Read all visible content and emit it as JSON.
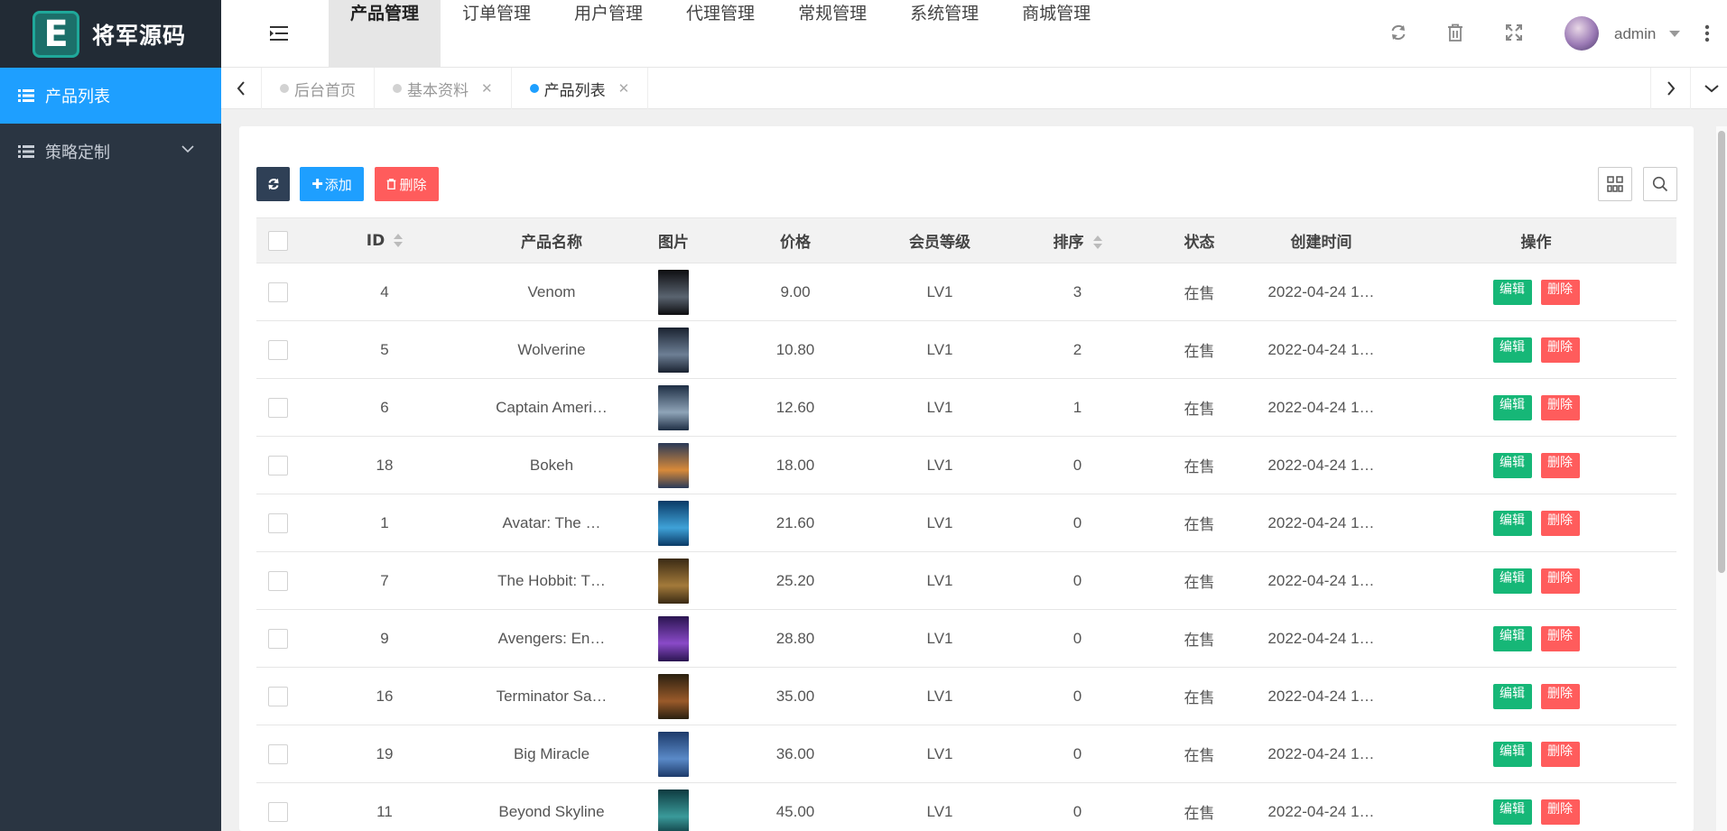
{
  "brand": {
    "logo_letter": "E",
    "name": "将军源码",
    "accent": "#1e9fff"
  },
  "sidebar": {
    "items": [
      {
        "label": "产品列表",
        "active": true
      },
      {
        "label": "策略定制",
        "active": false
      }
    ]
  },
  "header": {
    "nav": [
      {
        "label": "产品管理",
        "active": true
      },
      {
        "label": "订单管理",
        "active": false
      },
      {
        "label": "用户管理",
        "active": false
      },
      {
        "label": "代理管理",
        "active": false
      },
      {
        "label": "常规管理",
        "active": false
      },
      {
        "label": "系统管理",
        "active": false
      },
      {
        "label": "商城管理",
        "active": false
      }
    ],
    "icons": [
      "refresh-icon",
      "trash-icon",
      "fullscreen-icon"
    ],
    "user": "admin"
  },
  "tabs": [
    {
      "label": "后台首页",
      "closable": false,
      "active": false
    },
    {
      "label": "基本资料",
      "closable": true,
      "active": false
    },
    {
      "label": "产品列表",
      "closable": true,
      "active": true
    }
  ],
  "toolbar": {
    "add_label": "添加",
    "delete_label": "删除"
  },
  "table": {
    "columns": [
      "ID",
      "产品名称",
      "图片",
      "价格",
      "会员等级",
      "排序",
      "状态",
      "创建时间",
      "操作"
    ],
    "edit_label": "编辑",
    "delete_label": "删除",
    "rows": [
      {
        "id": "4",
        "name": "Venom",
        "price": "9.00",
        "level": "LV1",
        "sort": "3",
        "status": "在售",
        "created": "2022-04-24 1…"
      },
      {
        "id": "5",
        "name": "Wolverine",
        "price": "10.80",
        "level": "LV1",
        "sort": "2",
        "status": "在售",
        "created": "2022-04-24 1…"
      },
      {
        "id": "6",
        "name": "Captain Ameri…",
        "price": "12.60",
        "level": "LV1",
        "sort": "1",
        "status": "在售",
        "created": "2022-04-24 1…"
      },
      {
        "id": "18",
        "name": "Bokeh",
        "price": "18.00",
        "level": "LV1",
        "sort": "0",
        "status": "在售",
        "created": "2022-04-24 1…"
      },
      {
        "id": "1",
        "name": "Avatar: The …",
        "price": "21.60",
        "level": "LV1",
        "sort": "0",
        "status": "在售",
        "created": "2022-04-24 1…"
      },
      {
        "id": "7",
        "name": "The Hobbit: T…",
        "price": "25.20",
        "level": "LV1",
        "sort": "0",
        "status": "在售",
        "created": "2022-04-24 1…"
      },
      {
        "id": "9",
        "name": "Avengers: En…",
        "price": "28.80",
        "level": "LV1",
        "sort": "0",
        "status": "在售",
        "created": "2022-04-24 1…"
      },
      {
        "id": "16",
        "name": "Terminator Sa…",
        "price": "35.00",
        "level": "LV1",
        "sort": "0",
        "status": "在售",
        "created": "2022-04-24 1…"
      },
      {
        "id": "19",
        "name": "Big Miracle",
        "price": "36.00",
        "level": "LV1",
        "sort": "0",
        "status": "在售",
        "created": "2022-04-24 1…"
      },
      {
        "id": "11",
        "name": "Beyond Skyline",
        "price": "45.00",
        "level": "LV1",
        "sort": "0",
        "status": "在售",
        "created": "2022-04-24 1…"
      }
    ]
  }
}
